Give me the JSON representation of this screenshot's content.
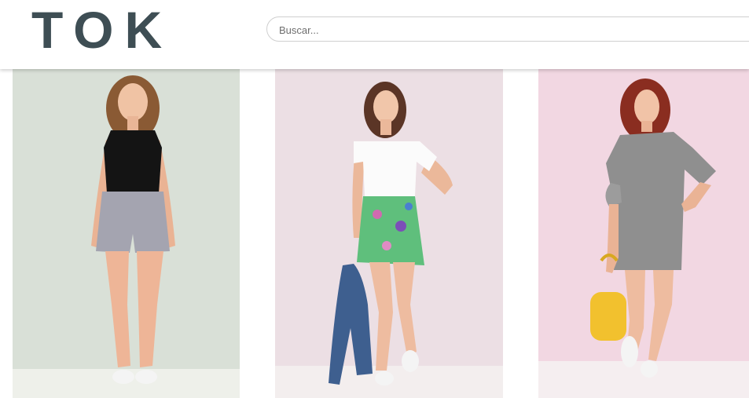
{
  "header": {
    "logo_text": "TOK",
    "search": {
      "placeholder": "Buscar...",
      "value": ""
    }
  },
  "products": [
    {
      "image": "product-photo-black-top-grey-shorts",
      "bg_color": "#d8dfd6"
    },
    {
      "image": "product-photo-white-top-floral-skirt",
      "bg_color": "#ecdfe4"
    },
    {
      "image": "product-photo-grey-dress-yellow-backpack",
      "bg_color": "#f2d6e1"
    }
  ]
}
